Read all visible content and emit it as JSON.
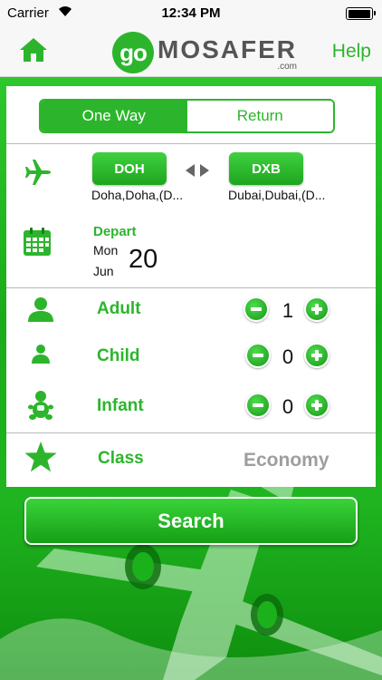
{
  "status_bar": {
    "carrier": "Carrier",
    "time": "12:34 PM",
    "battery_level": 1.0
  },
  "nav": {
    "help": "Help",
    "logo_go": "go",
    "logo_brand": "MOSAFER",
    "logo_domain": ".com"
  },
  "trip_type": {
    "one_way": "One Way",
    "return": "Return",
    "selected": "One Way"
  },
  "route": {
    "origin_code": "DOH",
    "origin_city": "Doha,Doha,(D...",
    "destination_code": "DXB",
    "destination_city": "Dubai,Dubai,(D..."
  },
  "depart": {
    "label": "Depart",
    "weekday": "Mon",
    "month": "Jun",
    "day": "20"
  },
  "passengers": [
    {
      "label": "Adult",
      "count": "1"
    },
    {
      "label": "Child",
      "count": "0"
    },
    {
      "label": "Infant",
      "count": "0"
    }
  ],
  "class": {
    "label": "Class",
    "value": "Economy"
  },
  "search_label": "Search",
  "colors": {
    "accent": "#2cb52c",
    "muted": "#9e9e9e"
  },
  "icons": [
    "home-icon",
    "plane-icon",
    "calendar-icon",
    "adult-icon",
    "child-icon",
    "infant-icon",
    "star-icon",
    "swap-icon",
    "minus-icon",
    "plus-icon"
  ]
}
